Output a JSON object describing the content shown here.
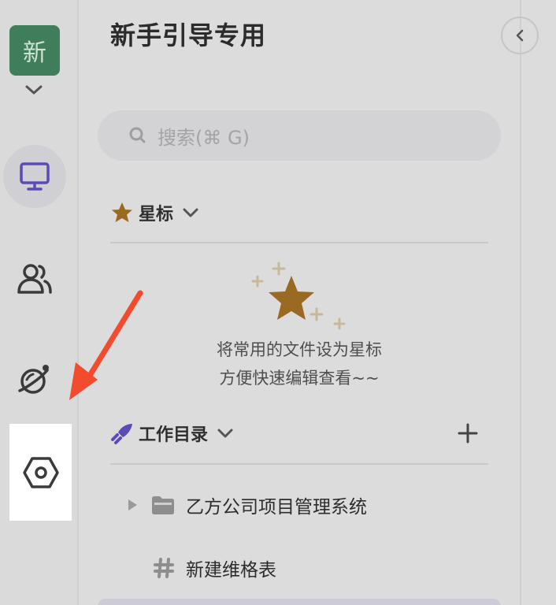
{
  "workspace": {
    "avatar_text": "新",
    "title": "新手引导专用"
  },
  "rail": {
    "items": [
      {
        "name": "workspace-desktop",
        "icon": "monitor-icon",
        "active": true
      },
      {
        "name": "members",
        "icon": "people-icon",
        "active": false
      },
      {
        "name": "explore",
        "icon": "planet-icon",
        "active": false
      },
      {
        "name": "settings",
        "icon": "hexagon-settings-icon",
        "active": false
      }
    ]
  },
  "search": {
    "placeholder": "搜索(⌘ G)"
  },
  "starred": {
    "label": "星标",
    "empty_line1": "将常用的文件设为星标",
    "empty_line2": "方便快速编辑查看~~"
  },
  "directory": {
    "label": "工作目录",
    "items": [
      {
        "label": "乙方公司项目管理系统",
        "icon": "folder-icon",
        "expandable": true
      },
      {
        "label": "新建维格表",
        "icon": "hash-icon",
        "expandable": false
      }
    ]
  },
  "colors": {
    "accent": "#5b4bb5",
    "star": "#9a6a22",
    "avatar_bg": "#3f7d5b",
    "annotation_arrow": "#f24b2e"
  }
}
